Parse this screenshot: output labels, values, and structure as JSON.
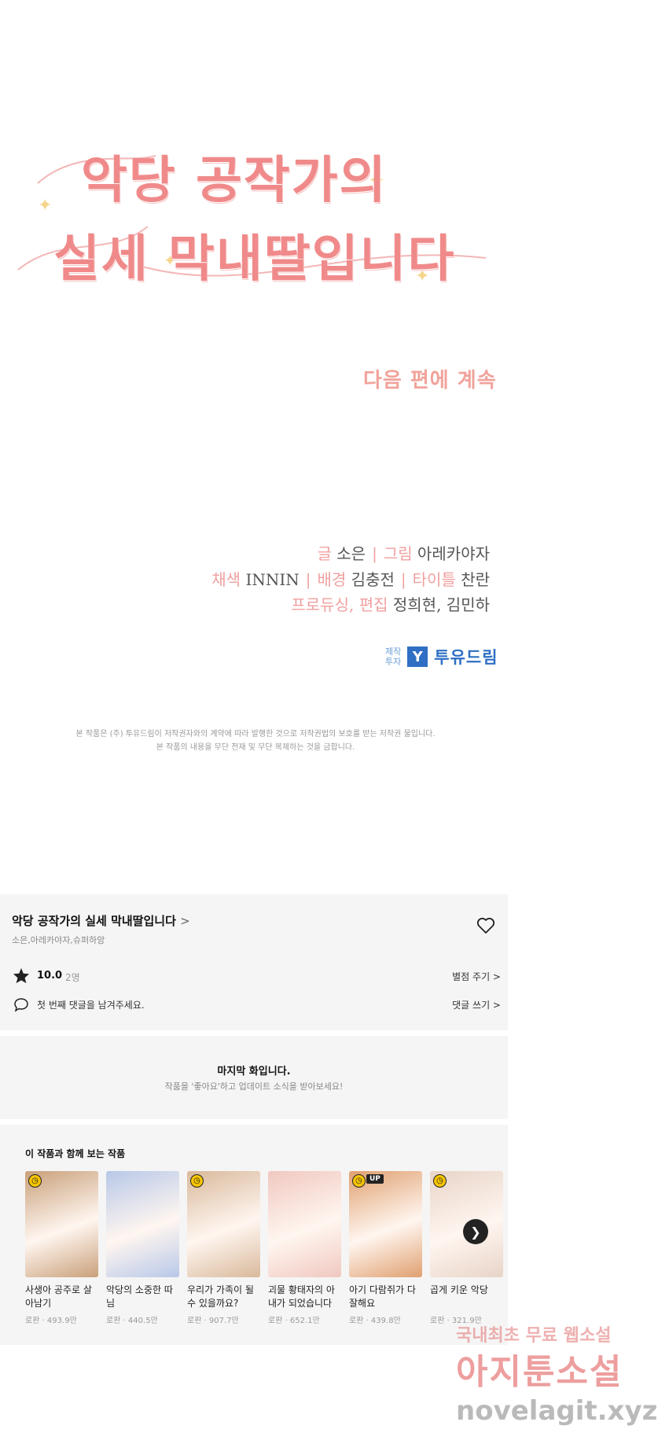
{
  "title_art": {
    "line1": "악당 공작가의",
    "line2": "실세 막내딸입니다",
    "next_episode": "다음 편에 계속"
  },
  "credits": {
    "line1": [
      {
        "role": "글",
        "name": "소은"
      },
      {
        "role": "그림",
        "name": "아레카야자"
      }
    ],
    "line2": [
      {
        "role": "채색",
        "name": "INNIN"
      },
      {
        "role": "배경",
        "name": "김충전"
      },
      {
        "role": "타이틀",
        "name": "찬란"
      }
    ],
    "line3": [
      {
        "role": "프로듀싱, 편집",
        "name": "정희현, 김민하"
      }
    ]
  },
  "producer": {
    "label_top": "제작",
    "label_bottom": "투자",
    "logo_glyph": "Y",
    "name": "투유드림"
  },
  "copyright": {
    "line1": "본 작품은 (주) 투유드림이 저작권자와의 계약에 따라 발행한 것으로 저작권법의 보호를 받는 저작권 물입니다.",
    "line2": "본 작품의 내용을 무단 전재 및 무단 복제하는 것을 금합니다."
  },
  "series": {
    "title": "악당 공작가의 실세 막내딸입니다",
    "title_chevron": ">",
    "authors": "소은,아레카야자,슈퍼하앙",
    "rating": "10.0",
    "rating_count": "2명",
    "rate_link": "별점 주기 >",
    "comment_prompt": "첫 번째 댓글을 남겨주세요.",
    "comment_link": "댓글 쓰기 >"
  },
  "last_episode": {
    "title": "마지막 화입니다.",
    "subtitle": "작품을 '좋아요'하고 업데이트 소식을 받아보세요!"
  },
  "recommendations": {
    "heading": "이 작품과 함께 보는 작품",
    "items": [
      {
        "title": "사생아 공주로 살아남기",
        "meta": "로판 · 493.9만",
        "badge": "clock",
        "up": false,
        "color": "#c9a07a"
      },
      {
        "title": "악당의 소중한 따님",
        "meta": "로판 · 440.5만",
        "badge": "none",
        "up": false,
        "color": "#b8c8e8"
      },
      {
        "title": "우리가 가족이 될 수 있을까요?",
        "meta": "로판 · 907.7만",
        "badge": "clock",
        "up": false,
        "color": "#d9b99b"
      },
      {
        "title": "괴물 황태자의 아내가 되었습니다",
        "meta": "로판 · 652.1만",
        "badge": "none",
        "up": false,
        "color": "#f0c8c0"
      },
      {
        "title": "아기 다람쥐가 다 잘해요",
        "meta": "로판 · 439.8만",
        "badge": "clock",
        "up": true,
        "up_label": "UP",
        "color": "#e0a070"
      },
      {
        "title": "곱게 키운 악당",
        "meta": "로판 · 321.9만",
        "badge": "clock",
        "up": false,
        "color": "#e8d4c8"
      }
    ]
  },
  "watermark": {
    "line1": "국내최초 무료 웹소설",
    "line2": "아지툰소설",
    "line3": "novelagit.xyz"
  },
  "icons": {
    "heart": "heart-icon",
    "star": "star-icon",
    "comment": "speech-bubble-icon",
    "next": "chevron-right-icon"
  },
  "colors": {
    "title_pink": "#f08a8a",
    "producer_blue": "#2f6fc4",
    "panel_bg": "#f5f5f5"
  }
}
